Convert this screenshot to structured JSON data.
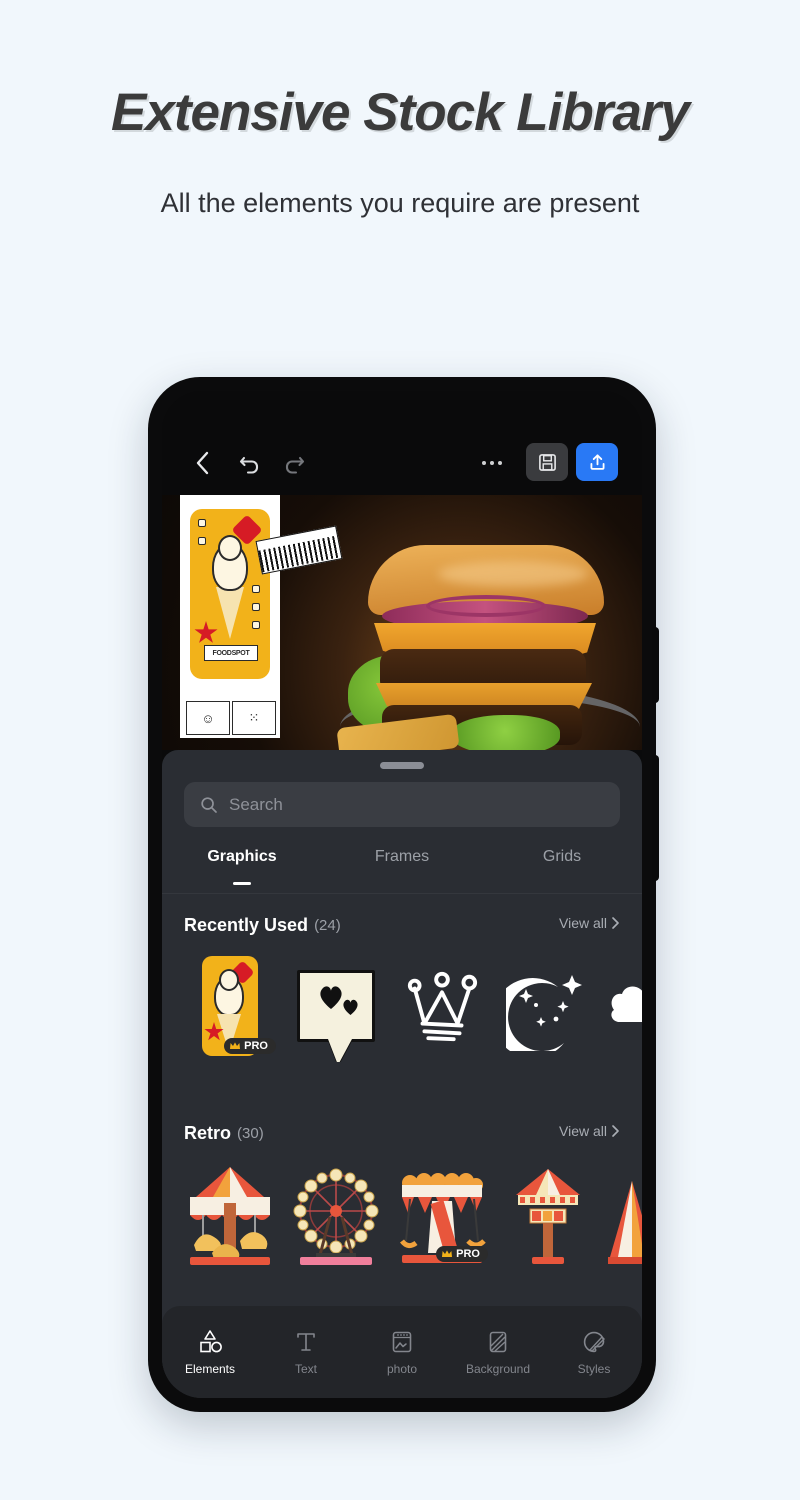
{
  "promo": {
    "headline": "Extensive Stock Library",
    "subhead": "All the elements you require are present"
  },
  "app": {
    "toolbar": {
      "back_icon": "chevron-left-icon",
      "undo_icon": "undo-icon",
      "redo_icon": "redo-icon",
      "more_icon": "more-horizontal-icon",
      "save_icon": "floppy-disk-icon",
      "export_icon": "upload-icon",
      "export_bg": "#2979f5",
      "save_bg": "#3a3b3e"
    },
    "canvas": {
      "photo_subject": "double cheeseburger on plate",
      "sticker_label": "FOODSPOT",
      "sticker_elements": [
        "ice-cream-card",
        "barcode-sticker",
        "smiley-tile",
        "scatter-tile"
      ]
    },
    "sheet": {
      "handle": "drag-handle",
      "search": {
        "placeholder": "Search",
        "icon": "search-icon"
      },
      "tabs": [
        {
          "label": "Graphics",
          "active": true
        },
        {
          "label": "Frames",
          "active": false
        },
        {
          "label": "Grids",
          "active": false
        }
      ],
      "sections": [
        {
          "title": "Recently Used",
          "count": "(24)",
          "view_all": "View all",
          "chevron": "chevron-right-icon",
          "items": [
            {
              "name": "ice-cream-card-sticker",
              "pro": true,
              "pro_label": "PRO"
            },
            {
              "name": "speech-bubble-hearts-sticker",
              "pro": false
            },
            {
              "name": "crown-sketch-sticker",
              "pro": false
            },
            {
              "name": "crescent-moon-stars-sticker",
              "pro": false
            },
            {
              "name": "cloud-sticker",
              "pro": false
            }
          ]
        },
        {
          "title": "Retro",
          "count": "(30)",
          "view_all": "View all",
          "chevron": "chevron-right-icon",
          "items": [
            {
              "name": "carousel-sticker",
              "pro": false
            },
            {
              "name": "ferris-wheel-sticker",
              "pro": false
            },
            {
              "name": "swing-ride-sticker",
              "pro": true,
              "pro_label": "PRO"
            },
            {
              "name": "striped-kiosk-sticker",
              "pro": false
            },
            {
              "name": "circus-tent-sticker",
              "pro": false
            }
          ]
        }
      ]
    },
    "bottom_nav": [
      {
        "label": "Elements",
        "icon": "shapes-icon",
        "active": true
      },
      {
        "label": "Text",
        "icon": "text-t-icon",
        "active": false
      },
      {
        "label": "photo",
        "icon": "photo-icon",
        "active": false
      },
      {
        "label": "Background",
        "icon": "background-icon",
        "active": false
      },
      {
        "label": "Styles",
        "icon": "palette-icon",
        "active": false
      }
    ]
  },
  "colors": {
    "page_bg": "#f1f7fc",
    "panel_bg": "#2a2d33",
    "nav_bg": "#232529",
    "accent_blue": "#2979f5",
    "sticker_yellow": "#f2b21a"
  }
}
